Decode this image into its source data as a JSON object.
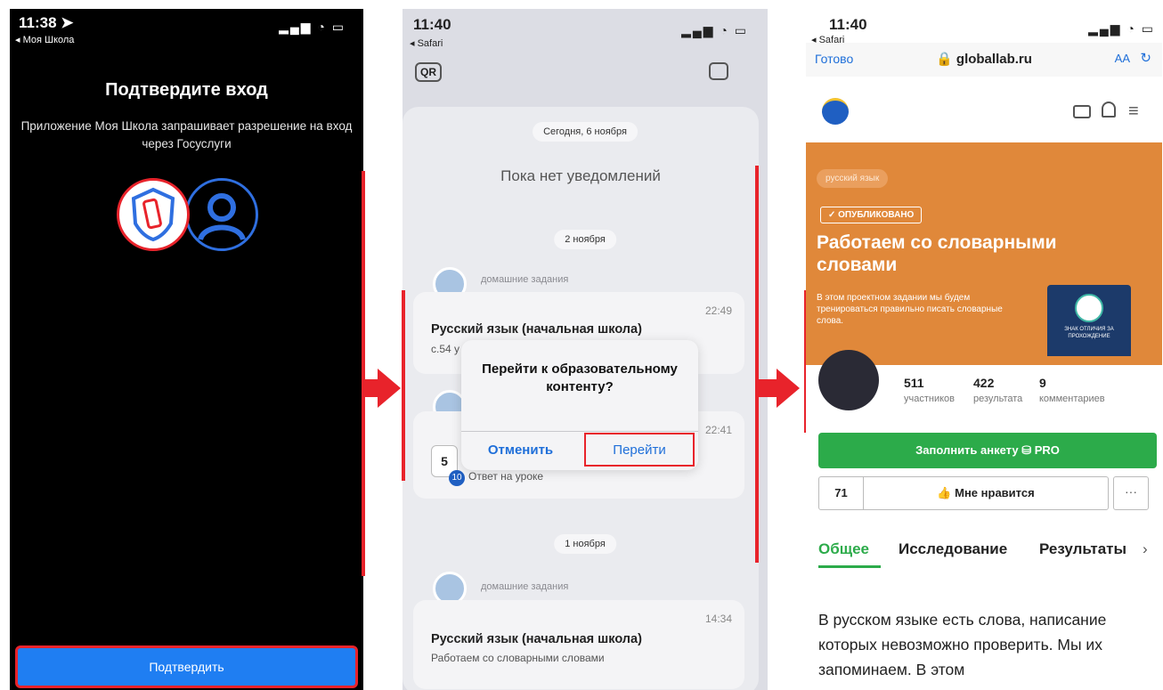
{
  "phone1": {
    "status_time": "11:38 ➤",
    "status_back": "◂ Моя Школа",
    "status_icons": "▂▄▆ ◔ ▭",
    "title": "Подтвердите вход",
    "description": "Приложение Моя Школа запрашивает разрешение на вход через Госуслуги",
    "confirm_label": "Подтвердить"
  },
  "phone2": {
    "status_time": "11:40",
    "status_back": "◂ Safari",
    "status_icons": "▂▄▆ ◔ ▭",
    "qr_icon": "QR",
    "date_today": "Сегодня, 6 ноября",
    "empty_text": "Пока нет уведомлений",
    "date_nov2": "2 ноября",
    "category_homework": "домашние задания",
    "note1_title": "Русский язык (начальная школа)",
    "note1_time": "22:49",
    "note1_sub": "с.54 у",
    "note2_time": "22:41",
    "note2_grade": "5",
    "note2_badge": "10",
    "note2_sub": "Ответ на уроке",
    "date_nov1": "1 ноября",
    "note3_title": "Русский язык (начальная школа)",
    "note3_time": "14:34",
    "note3_sub": "Работаем со словарными словами",
    "dialog_question": "Перейти к образовательному контенту?",
    "dialog_cancel": "Отменить",
    "dialog_go": "Перейти"
  },
  "phone3": {
    "status_time": "11:40",
    "status_back": "◂ Safari",
    "status_icons": "▂▄▆ ◔ ▭",
    "done_label": "Готово",
    "url": "🔒 globallab.ru",
    "aa_label": "AA",
    "reload_icon": "↻",
    "tag_subject": "русский язык",
    "tag_published": "✓ ОПУБЛИКОВАНО",
    "banner_title": "Работаем со словарными словами",
    "banner_desc": "В этом проектном задании мы будем тренироваться правильно писать словарные слова.",
    "badge_text": "ЗНАК ОТЛИЧИЯ ЗА ПРОХОЖДЕНИЕ",
    "stats": [
      {
        "num": "511",
        "label": "участников"
      },
      {
        "num": "422",
        "label": "результата"
      },
      {
        "num": "9",
        "label": "комментариев"
      }
    ],
    "fill_button": "Заполнить анкету  ⛁ PRO",
    "likes_count": "71",
    "like_label": "👍 Мне нравится",
    "more_label": "···",
    "tab_general": "Общее",
    "tab_research": "Исследование",
    "tab_results": "Результаты",
    "tabs_chevron": "›",
    "body_text": "В русском языке есть слова, написание которых невозможно проверить. Мы их запоминаем. В этом"
  },
  "colors": {
    "accent_red": "#e8232b",
    "ios_blue": "#1f7ef2",
    "banner_orange": "#e0883a",
    "green": "#2cab4a"
  }
}
